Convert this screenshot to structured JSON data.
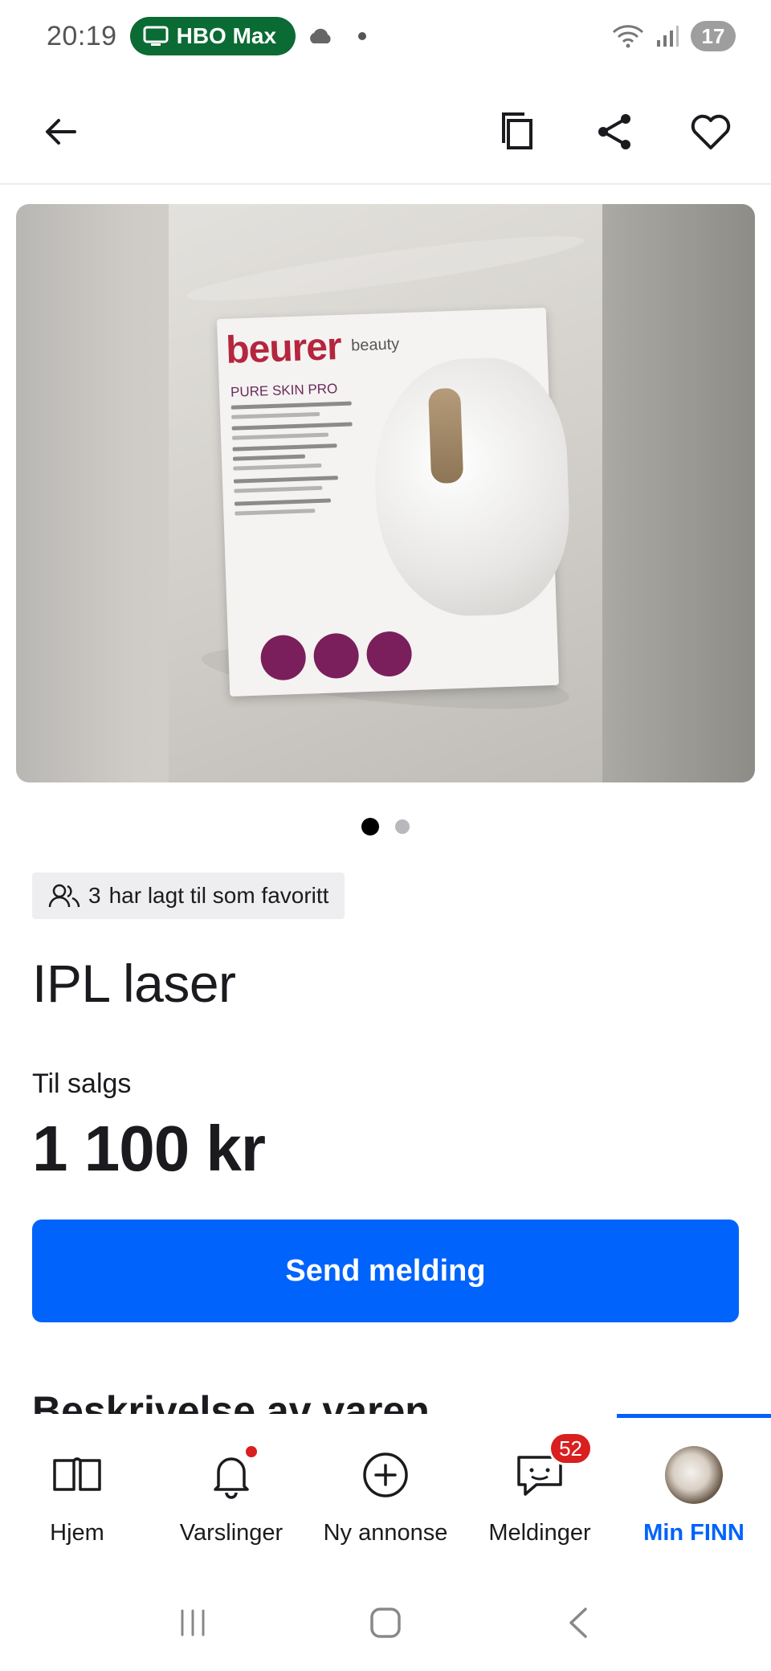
{
  "status_bar": {
    "time": "20:19",
    "app_pill": "HBO Max",
    "battery": "17"
  },
  "listing": {
    "favorites_count": "3",
    "favorites_text": "har lagt til som favoritt",
    "title": "IPL laser",
    "sale_type": "Til salgs",
    "price": "1 100 kr",
    "send_button": "Send melding",
    "section_title": "Beskrivelse av varen",
    "image_page_current": 1,
    "image_page_total": 2
  },
  "tabbar": {
    "items": [
      {
        "label": "Hjem",
        "icon": "book-icon"
      },
      {
        "label": "Varslinger",
        "icon": "bell-icon"
      },
      {
        "label": "Ny annonse",
        "icon": "plus-circle-icon"
      },
      {
        "label": "Meldinger",
        "icon": "chat-icon",
        "badge": "52"
      },
      {
        "label": "Min FINN",
        "icon": "avatar",
        "active": true
      }
    ]
  },
  "colors": {
    "accent": "#0063fb",
    "badge": "#d91f1f",
    "hbo_pill": "#0b6b34"
  }
}
